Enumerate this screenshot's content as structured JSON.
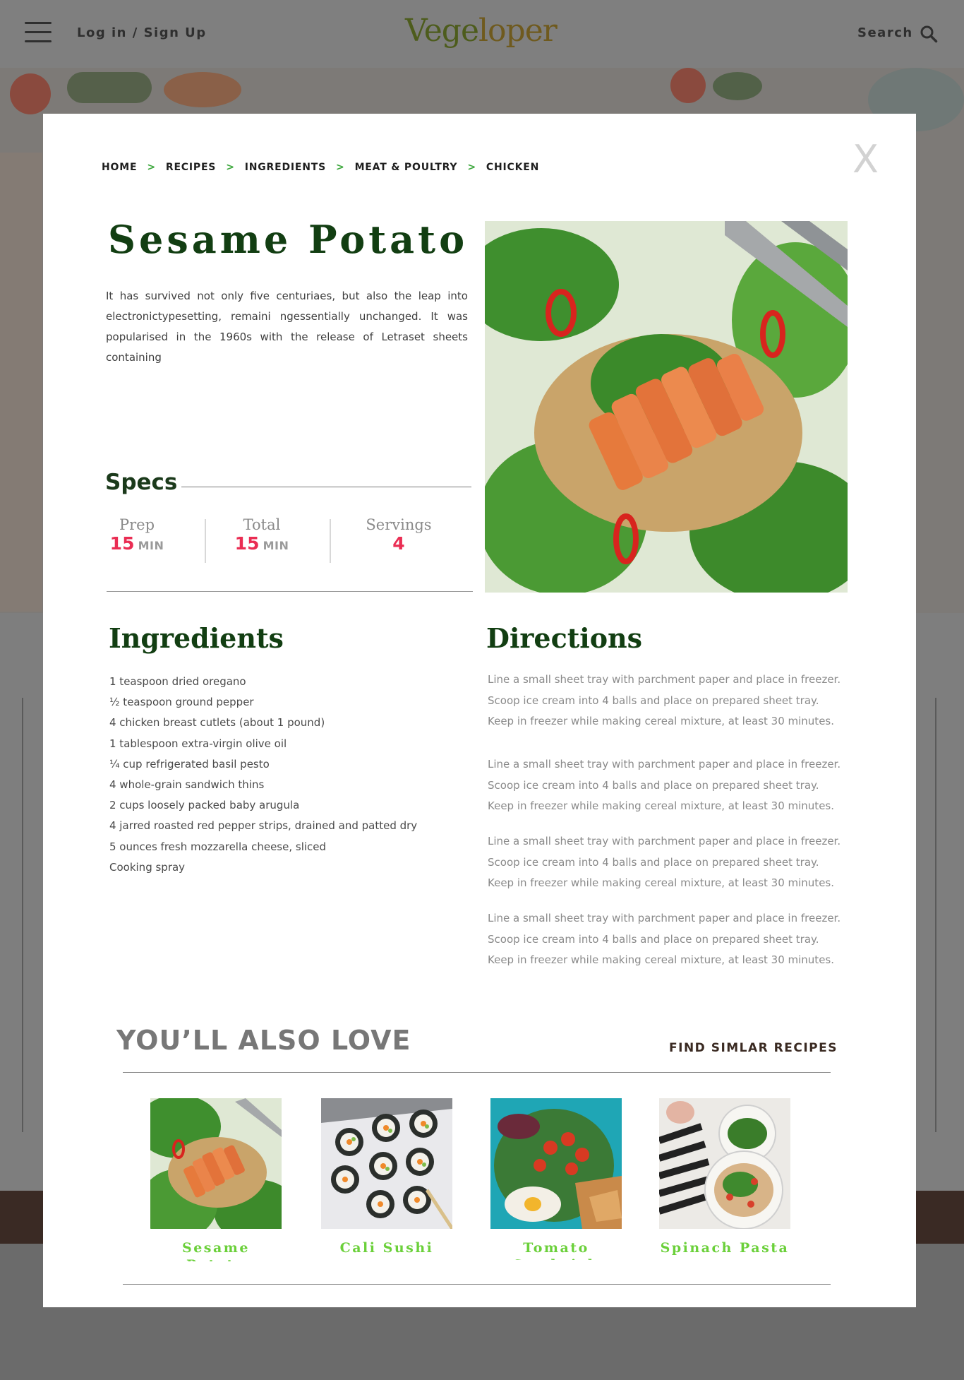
{
  "header": {
    "login_label": "Log in / Sign Up",
    "logo_part1": "Vege",
    "logo_part2": "loper",
    "search_label": "Search"
  },
  "modal": {
    "close_label": "X",
    "breadcrumb": [
      "HOME",
      "RECIPES",
      "INGREDIENTS",
      "MEAT & POULTRY",
      "CHICKEN"
    ],
    "title": "Sesame Potato",
    "intro": "It has survived not only five centuriaes, but also the leap into electronictypesetting, remaini ngessentially unchanged. It was popularised in the 1960s with the release of Letraset sheets containing",
    "specs": {
      "heading": "Specs",
      "prep": {
        "label": "Prep",
        "value": "15",
        "unit": "MIN"
      },
      "total": {
        "label": "Total",
        "value": "15",
        "unit": "MIN"
      },
      "servings": {
        "label": "Servings",
        "value": "4"
      }
    },
    "ingredients_heading": "Ingredients",
    "ingredients": [
      "1 teaspoon dried oregano",
      "½ teaspoon ground pepper",
      "4 chicken breast cutlets (about 1 pound)",
      "1 tablespoon extra-virgin olive oil",
      "¼ cup refrigerated basil pesto",
      "4 whole-grain sandwich thins",
      "2 cups loosely packed baby arugula",
      "4 jarred roasted red pepper strips, drained and patted dry",
      "5 ounces fresh mozzarella cheese, sliced",
      "Cooking spray"
    ],
    "directions_heading": "Directions",
    "directions": [
      [
        "Line a small sheet tray with parchment paper and place in freezer.",
        "Scoop ice cream into 4 balls and place on prepared sheet tray.",
        "Keep in freezer while making cereal mixture, at least 30 minutes."
      ],
      [
        "Line a small sheet tray with parchment paper and place in freezer.",
        "Scoop ice cream into 4 balls and place on prepared sheet tray.",
        "Keep in freezer while making cereal mixture, at least 30 minutes."
      ],
      [
        "Line a small sheet tray with parchment paper and place in freezer.",
        "Scoop ice cream into 4 balls and place on prepared sheet tray.",
        "Keep in freezer while making cereal mixture, at least 30 minutes."
      ],
      [
        "Line a small sheet tray with parchment paper and place in freezer.",
        "Scoop ice cream into 4 balls and place on prepared sheet tray.",
        "Keep in freezer while making cereal mixture, at least 30 minutes."
      ]
    ],
    "also_love": {
      "heading": "YOU’LL ALSO LOVE",
      "find_link": "FIND SIMLAR RECIPES",
      "cards": [
        "Sesame Potato",
        "Cali Sushi",
        "Tomato Sandwich",
        "Spinach Pasta"
      ]
    }
  },
  "colors": {
    "title_green": "#123e12",
    "accent_pink": "#ea2d53",
    "card_title_green": "#6bd03a",
    "breadcrumb_chevron": "#3aa63a"
  }
}
